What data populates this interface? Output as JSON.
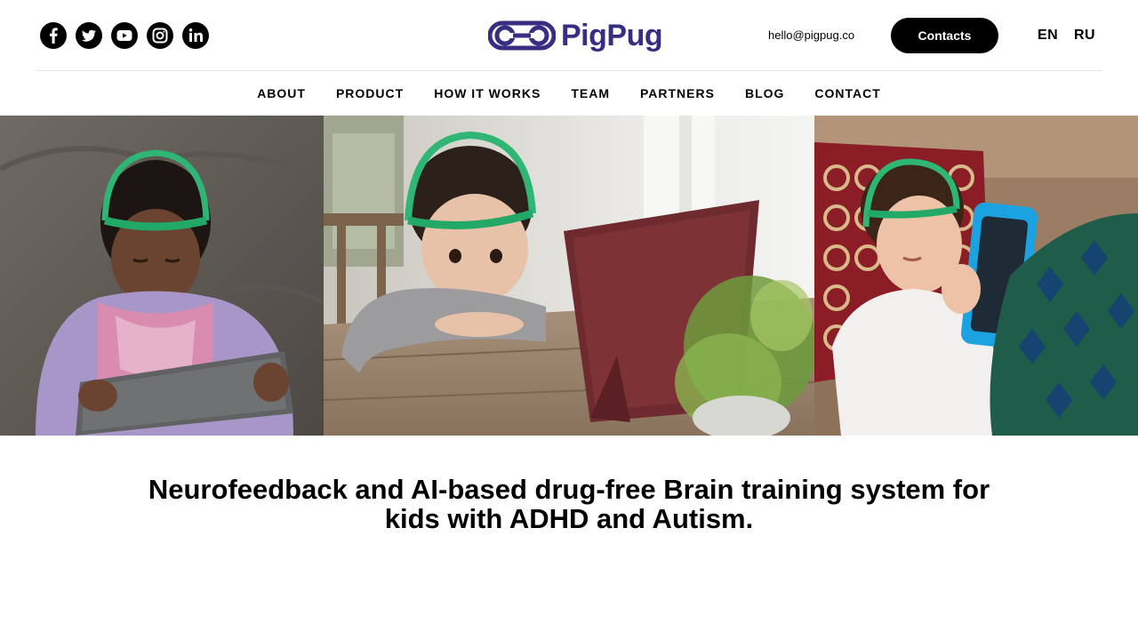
{
  "header": {
    "socials": [
      {
        "icon": "facebook-icon"
      },
      {
        "icon": "twitter-icon"
      },
      {
        "icon": "youtube-icon"
      },
      {
        "icon": "instagram-icon"
      },
      {
        "icon": "linkedin-icon"
      }
    ],
    "logo_text": "PigPug",
    "logo_color": "#372e84",
    "email": "hello@pigpug.co",
    "contacts_label": "Contacts",
    "languages": [
      "EN",
      "RU"
    ]
  },
  "nav": {
    "items": [
      "ABOUT",
      "PRODUCT",
      "HOW IT WORKS",
      "TEAM",
      "PARTNERS",
      "BLOG",
      "CONTACT"
    ]
  },
  "hero": {
    "panels": [
      {
        "name": "child-with-tablet-on-couch-photo"
      },
      {
        "name": "child-at-table-watching-tablet-photo"
      },
      {
        "name": "boy-on-sofa-with-tablet-photo"
      }
    ],
    "headband_color": "#22a867"
  },
  "headline": "Neurofeedback and AI-based drug-free Brain training system for kids with ADHD and Autism."
}
